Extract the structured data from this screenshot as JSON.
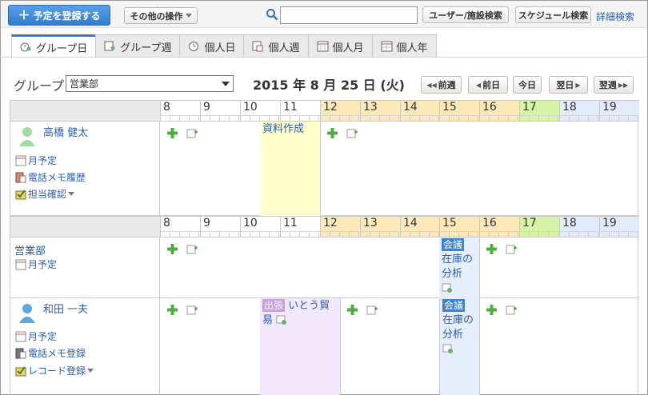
{
  "toolbar": {
    "register_label": "予定を登録する",
    "other_ops_label": "その他の操作",
    "search_value": "",
    "user_facility_search": "ユーザー/施設検索",
    "schedule_search": "スケジュール検索",
    "advanced_search": "詳細検索"
  },
  "tabs": [
    {
      "label": "グループ日",
      "active": true
    },
    {
      "label": "グループ週"
    },
    {
      "label": "個人日"
    },
    {
      "label": "個人週"
    },
    {
      "label": "個人月"
    },
    {
      "label": "個人年"
    }
  ],
  "group": {
    "label": "グループ",
    "selected": "営業部"
  },
  "date_title": "2015 年 8 月 25 日 (火)",
  "nav": {
    "prev_week": "前週",
    "prev_day": "前日",
    "today": "今日",
    "next_day": "翌日",
    "next_week": "翌週"
  },
  "hours": [
    "8",
    "9",
    "10",
    "11",
    "12",
    "13",
    "14",
    "15",
    "16",
    "17",
    "18",
    "19"
  ],
  "users": [
    {
      "name": "高橋 健太",
      "links": [
        "月予定",
        "電話メモ履歴",
        "担当確認"
      ],
      "events": [
        {
          "title": "資料作成"
        }
      ]
    },
    {
      "name": "営業部",
      "links": [
        "月予定"
      ],
      "events": [
        {
          "tag": "会議",
          "title": "在庫の分析"
        }
      ]
    },
    {
      "name": "和田 一夫",
      "links": [
        "月予定",
        "電話メモ登録",
        "レコード登録"
      ],
      "events": [
        {
          "tag": "出張",
          "title": "いとう貿易"
        },
        {
          "tag": "会議",
          "title": "在庫の分析"
        }
      ]
    }
  ],
  "colors": {
    "accent": "#3b78c4",
    "link": "#2a5db0",
    "hour_noon": "#fce8b8",
    "hour_evening": "#d6f3a6",
    "hour_night": "#e3ebfb"
  }
}
